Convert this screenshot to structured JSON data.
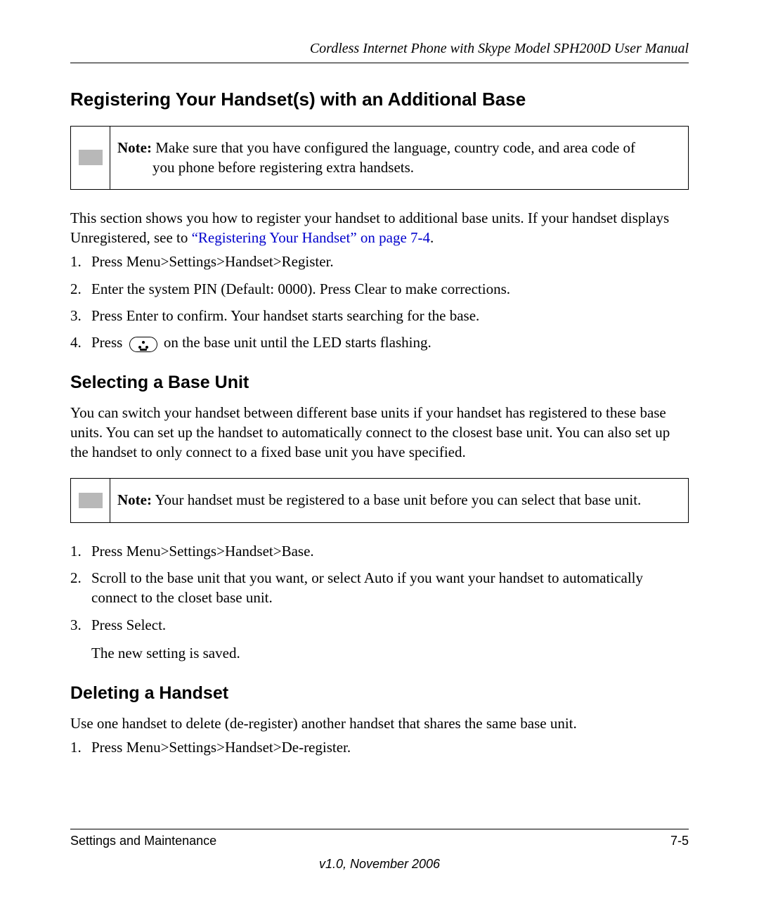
{
  "header": {
    "running_title": "Cordless Internet Phone with Skype Model SPH200D User Manual"
  },
  "sections": {
    "registering": {
      "heading": "Registering Your Handset(s) with an Additional Base",
      "note_label": "Note:",
      "note_line1": " Make sure that you have configured the language, country code, and area code of",
      "note_line2": "you phone before registering extra handsets.",
      "intro_pre": "This section shows you how to register your handset to additional base units. If your handset displays Unregistered, see to ",
      "intro_link": "“Registering Your Handset” on page 7-4",
      "intro_post": ".",
      "steps": {
        "s1": "Press Menu>Settings>Handset>Register.",
        "s2": "Enter the system PIN (Default: 0000). Press Clear to make corrections.",
        "s3": "Press Enter to confirm. Your handset starts searching for the base.",
        "s4_pre": "Press ",
        "s4_post": " on the base unit until the LED starts flashing."
      }
    },
    "selecting": {
      "heading": "Selecting a Base Unit",
      "body": "You can switch your handset between different base units if your handset has registered to these base units. You can set up the handset to automatically connect to the closest base unit. You can also set up the handset to only connect to a fixed base unit you have specified.",
      "note_label": "Note:",
      "note_text": " Your handset must be registered to a base unit before you can select that base unit.",
      "steps": {
        "s1": "Press Menu>Settings>Handset>Base.",
        "s2": "Scroll to the base unit that you want, or select Auto if you want your handset to automatically connect to the closet base unit.",
        "s3": "Press Select.",
        "s3_result": "The new setting is saved."
      }
    },
    "deleting": {
      "heading": "Deleting a Handset",
      "body": "Use one handset to delete (de-register) another handset that shares the same base unit.",
      "steps": {
        "s1": "Press Menu>Settings>Handset>De-register."
      }
    }
  },
  "footer": {
    "section_name": "Settings and Maintenance",
    "page_number": "7-5",
    "version": "v1.0, November 2006"
  }
}
